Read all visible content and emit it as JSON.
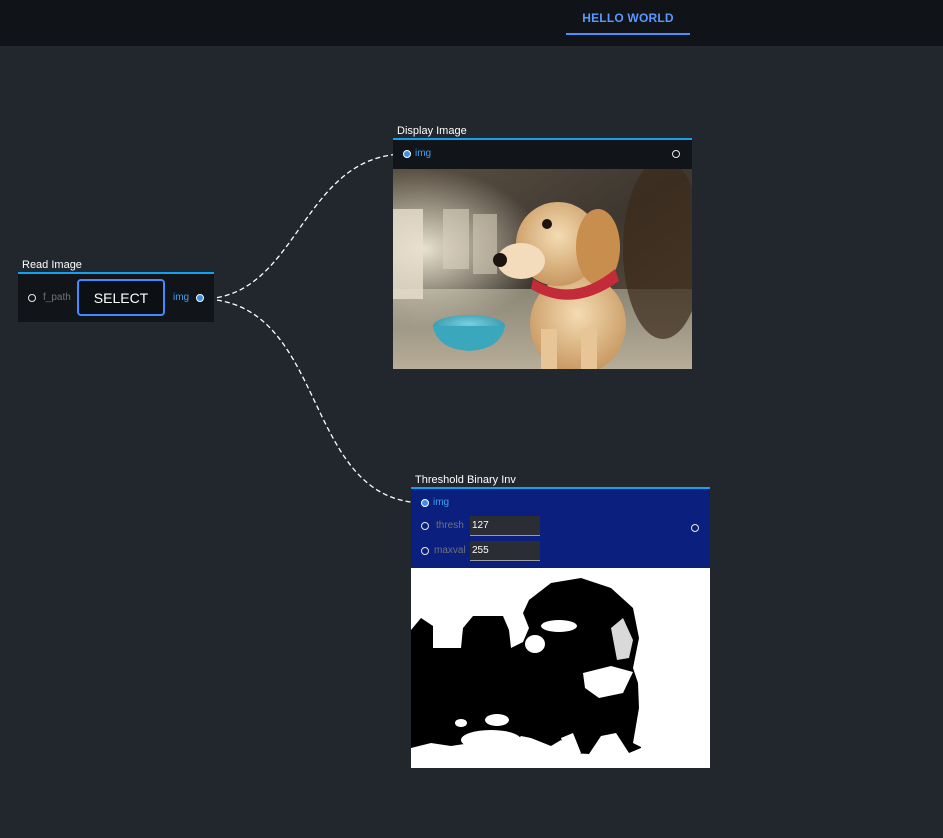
{
  "header": {
    "tab_label": "HELLO WORLD",
    "accent_color": "#4c8dff"
  },
  "nodes": {
    "read_image": {
      "title": "Read Image",
      "input_label": "f_path",
      "button_label": "SELECT",
      "output_label": "img"
    },
    "display_image": {
      "title": "Display Image",
      "input_label": "img"
    },
    "threshold": {
      "title": "Threshold Binary Inv",
      "input_label": "img",
      "thresh_label": "thresh",
      "thresh_value": "127",
      "maxval_label": "maxval",
      "maxval_value": "255"
    }
  },
  "colors": {
    "canvas_bg": "#22262d",
    "node_body": "#111418",
    "threshold_body": "#0b1f7e",
    "title_underline": "#14a0f0",
    "port_active": "#3ba0f0"
  },
  "icons": {
    "port_empty": "circle-outline",
    "port_connected": "circle-filled"
  }
}
